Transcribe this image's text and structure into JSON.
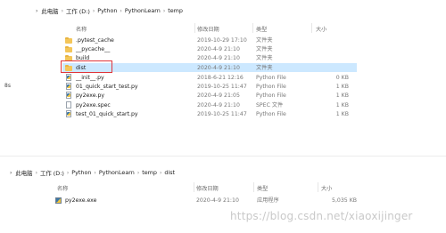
{
  "top": {
    "breadcrumb": [
      "此电脑",
      "工作 (D:)",
      "Python",
      "PythonLearn",
      "temp"
    ],
    "columns": {
      "name": "名称",
      "date": "修改日期",
      "type": "类型",
      "size": "大小"
    },
    "rows": [
      {
        "name": ".pytest_cache",
        "date": "2019-10-29 17:10",
        "type": "文件夹",
        "size": "",
        "icon": "folder-icon"
      },
      {
        "name": "__pycache__",
        "date": "2020-4-9 21:10",
        "type": "文件夹",
        "size": "",
        "icon": "folder-icon"
      },
      {
        "name": "build",
        "date": "2020-4-9 21:10",
        "type": "文件夹",
        "size": "",
        "icon": "folder-icon"
      },
      {
        "name": "dist",
        "date": "2020-4-9 21:10",
        "type": "文件夹",
        "size": "",
        "icon": "folder-icon",
        "selected": true
      },
      {
        "name": "__init__.py",
        "date": "2018-6-21 12:16",
        "type": "Python File",
        "size": "0 KB",
        "icon": "python-file-icon"
      },
      {
        "name": "01_quick_start_test.py",
        "date": "2019-10-25 11:47",
        "type": "Python File",
        "size": "1 KB",
        "icon": "python-file-icon"
      },
      {
        "name": "py2exe.py",
        "date": "2020-4-9 21:05",
        "type": "Python File",
        "size": "1 KB",
        "icon": "python-file-icon"
      },
      {
        "name": "py2exe.spec",
        "date": "2020-4-9 21:10",
        "type": "SPEC 文件",
        "size": "1 KB",
        "icon": "spec-file-icon"
      },
      {
        "name": "test_01_quick_start.py",
        "date": "2019-10-25 11:47",
        "type": "Python File",
        "size": "1 KB",
        "icon": "python-file-icon"
      }
    ]
  },
  "side_label": "8s",
  "bottom": {
    "breadcrumb": [
      "此电脑",
      "工作 (D:)",
      "Python",
      "PythonLearn",
      "temp",
      "dist"
    ],
    "columns": {
      "name": "名称",
      "date": "修改日期",
      "type": "类型",
      "size": "大小"
    },
    "rows": [
      {
        "name": "py2exe.exe",
        "date": "2020-4-9 21:10",
        "type": "应用程序",
        "size": "5,035 KB",
        "icon": "exe-file-icon"
      }
    ]
  },
  "watermark": "https://blog.csdn.net/xiaoxijinger",
  "colors": {
    "selection": "#cce8ff",
    "highlight_box": "#e0353b",
    "folder": "#f4c659"
  }
}
